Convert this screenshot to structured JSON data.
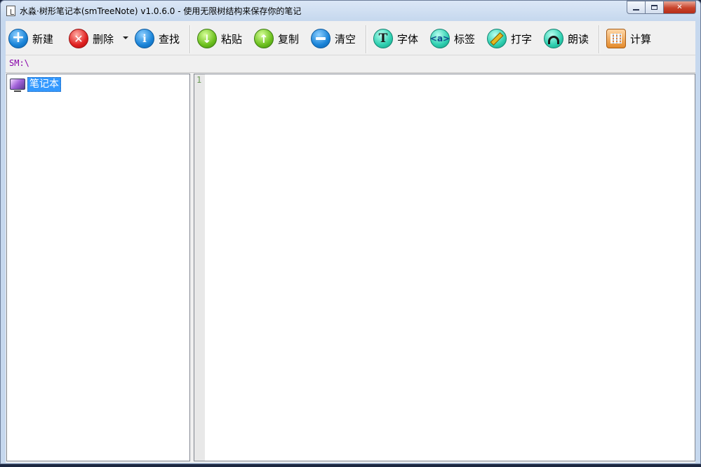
{
  "window": {
    "title": "水淼·树形笔记本(smTreeNote) v1.0.6.0 - 使用无限树结构来保存你的笔记"
  },
  "toolbar": {
    "new_label": "新建",
    "delete_label": "删除",
    "find_label": "查找",
    "paste_label": "粘贴",
    "copy_label": "复制",
    "clear_label": "清空",
    "font_label": "字体",
    "tag_label": "标签",
    "type_label": "打字",
    "read_label": "朗读",
    "calc_label": "计算",
    "font_icon_glyph": "T",
    "tag_icon_glyph": "<a>"
  },
  "path": {
    "text": "SM:\\"
  },
  "tree": {
    "items": [
      {
        "label": "笔记本",
        "icon": "monitor-icon",
        "selected": true
      }
    ]
  },
  "editor": {
    "line_numbers": [
      "1"
    ],
    "content": ""
  },
  "colors": {
    "selection": "#3399ff",
    "path_text": "#8800aa",
    "close_button": "#c8432b"
  }
}
